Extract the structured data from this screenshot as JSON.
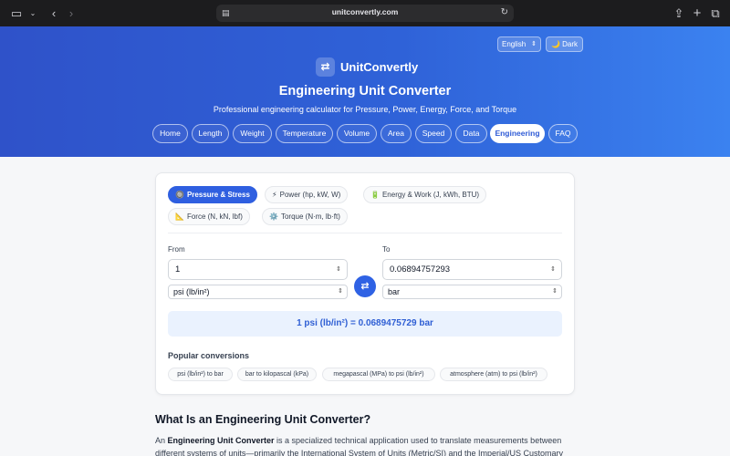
{
  "browser": {
    "url": "unitconvertly.com"
  },
  "header": {
    "language": "English",
    "dark_label": "🌙 Dark",
    "brand_name": "UnitConvertly",
    "title": "Engineering Unit Converter",
    "subtitle": "Professional engineering calculator for Pressure, Power, Energy, Force, and Torque",
    "nav": [
      {
        "label": "Home"
      },
      {
        "label": "Length"
      },
      {
        "label": "Weight"
      },
      {
        "label": "Temperature"
      },
      {
        "label": "Volume"
      },
      {
        "label": "Area"
      },
      {
        "label": "Speed"
      },
      {
        "label": "Data"
      },
      {
        "label": "Engineering",
        "active": true
      },
      {
        "label": "FAQ"
      }
    ]
  },
  "converter": {
    "categories": [
      {
        "emoji": "🔘",
        "label": "Pressure & Stress",
        "active": true
      },
      {
        "emoji": "⚡",
        "label": "Power (hp, kW, W)"
      },
      {
        "emoji": "🔋",
        "label": "Energy & Work (J, kWh, BTU)"
      },
      {
        "emoji": "📐",
        "label": "Force (N, kN, lbf)"
      },
      {
        "emoji": "⚙️",
        "label": "Torque (N·m, lb·ft)"
      }
    ],
    "from_label": "From",
    "to_label": "To",
    "from_value": "1",
    "to_value": "0.06894757293",
    "from_unit": "psi (lb/in²)",
    "to_unit": "bar",
    "result": "1 psi (lb/in²) = 0.0689475729 bar",
    "popular_title": "Popular conversions",
    "popular": [
      "psi (lb/in²) to bar",
      "bar to kilopascal (kPa)",
      "megapascal (MPa) to psi (lb/in²)",
      "atmosphere (atm) to psi (lb/in²)"
    ]
  },
  "article": {
    "heading": "What Is an Engineering Unit Converter?",
    "para_prefix": "An ",
    "para_bold": "Engineering Unit Converter",
    "para_rest": " is a specialized technical application used to translate measurements between different systems of units—primarily the International System of Units (Metric/SI) and the Imperial/US Customary"
  },
  "colors": {
    "accent": "#2f5fe0",
    "header_start": "#2f52c9",
    "header_end": "#3b82f0"
  }
}
